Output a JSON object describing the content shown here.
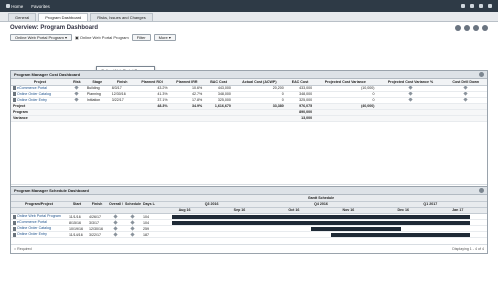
{
  "topbar": {
    "home": "Home",
    "favorites": "Favorites"
  },
  "tabs": [
    {
      "label": "General"
    },
    {
      "label": "Program Dashboard"
    },
    {
      "label": "Risks, Issues and Changes"
    }
  ],
  "page_title": "Overview: Program Dashboard",
  "filter": {
    "program_btn": "Online Web Portal Program",
    "crumb": "Online Web Portal Program",
    "filter_btn": "Filter",
    "more_btn": "More",
    "dropdown_option": "Online Web Portal Program"
  },
  "cost": {
    "title": "Program Manager Cost Dashboard",
    "columns": [
      "Project",
      "Risk",
      "Stage",
      "Finish",
      "Planned ROI",
      "Planned IRR",
      "BAC Cost",
      "Actual Cost (ACWP)",
      "EAC Cost",
      "Projected Cost Variance",
      "Projected Cost Variance %",
      "Cost Drill Down"
    ],
    "rows": [
      [
        "eCommerce Portal",
        "",
        "Building",
        "8/3/17",
        "43.2%",
        "10.6%",
        "443,000",
        "20,200",
        "433,000",
        "(10,000)",
        "",
        ""
      ],
      [
        "Online Order Catalog",
        "",
        "Planning",
        "12/30/16",
        "41.3%",
        "42.7%",
        "348,000",
        "0",
        "348,000",
        "0",
        "",
        ""
      ],
      [
        "Online Order Entry",
        "",
        "Initiation",
        "3/22/17",
        "37.1%",
        "17.8%",
        "325,000",
        "0",
        "325,000",
        "0",
        "",
        ""
      ]
    ],
    "totals": [
      {
        "label": "Project",
        "values": [
          "48.3%",
          "34.9%",
          "1,616,670",
          "33,380",
          "976,075",
          "(40,000)"
        ]
      },
      {
        "label": "Program",
        "values": [
          "",
          "",
          "",
          "",
          "890,000",
          ""
        ]
      },
      {
        "label": "Variance",
        "values": [
          "",
          "",
          "",
          "",
          "13,000",
          ""
        ]
      }
    ],
    "footer_left": "= Required",
    "footer_right": "Displaying 1 - 3 of 3"
  },
  "sched": {
    "title": "Program Manager Schedule Dashboard",
    "columns": [
      "Program/Project",
      "Start",
      "Finish",
      "Overall Status",
      "Schedule %",
      "Days Late"
    ],
    "gantt_title": "Gantt Schedule",
    "quarters": [
      "Q3 2016",
      "Q4 2016",
      "Q1 2017"
    ],
    "months": [
      "Aug 16",
      "Sep 16",
      "Oct 16",
      "Nov 16",
      "Dec 16",
      "Jan 17"
    ],
    "rows": [
      [
        "Online Web Portal Program",
        "11/1/16",
        "4/26/17",
        "",
        "",
        "104"
      ],
      [
        "eCommerce Portal",
        "8/15/16",
        "3/3/17",
        "",
        "",
        "104"
      ],
      [
        "Online Order Catalog",
        "10/19/16",
        "12/30/16",
        "",
        "",
        "259"
      ],
      [
        "Online Order Entry",
        "11/14/16",
        "3/22/17",
        "",
        "",
        "187"
      ]
    ],
    "footer_left": "= Required",
    "footer_right": "Displaying 1 - 4 of 4"
  }
}
